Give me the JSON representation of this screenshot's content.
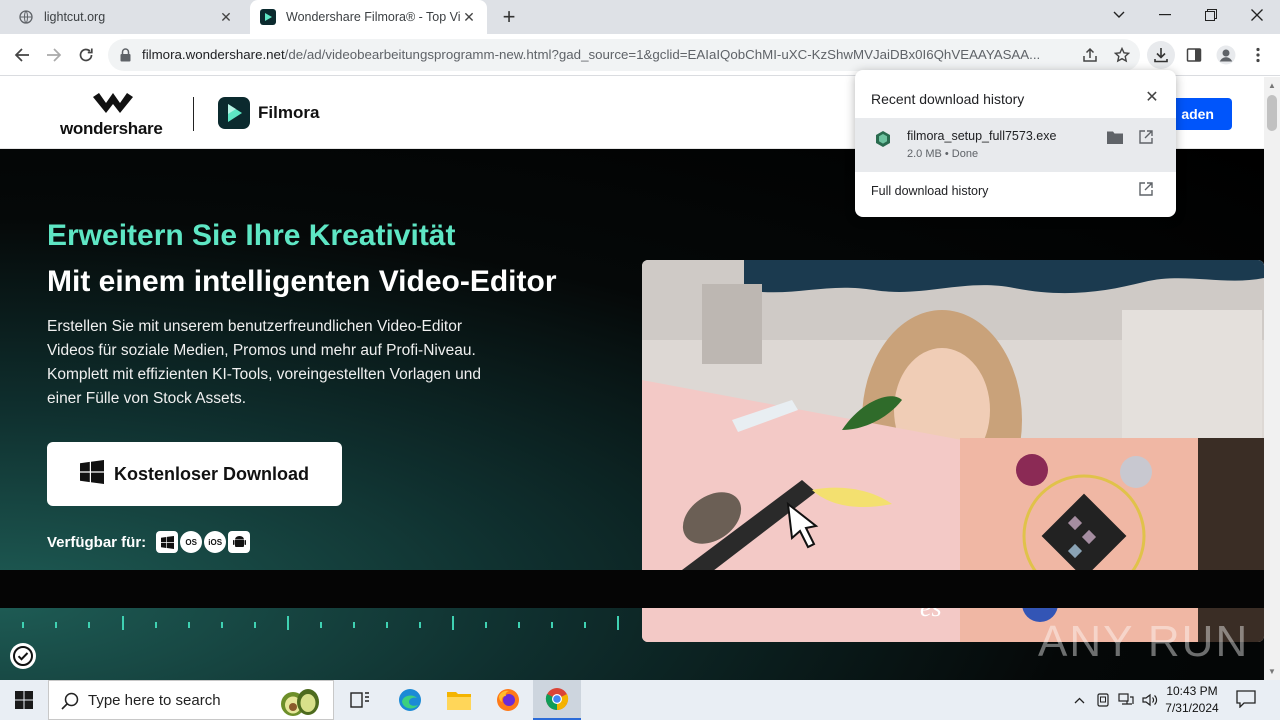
{
  "browser": {
    "tabs": [
      {
        "title": "lightcut.org",
        "active": false
      },
      {
        "title": "Wondershare Filmora® - Top Vi",
        "active": true
      }
    ],
    "new_tab": "+",
    "url_host": "filmora.wondershare.net",
    "url_path": "/de/ad/videobearbeitungsprogramm-new.html?gad_source=1&gclid=EAIaIQobChMI-uXC-KzShwMVJaiDBx0I6QhVEAAYASAA..."
  },
  "site": {
    "brand": "wondershare",
    "product": "Filmora",
    "header_cta": "aden"
  },
  "hero": {
    "title_1": "Erweitern Sie Ihre Kreativität",
    "title_2": "Mit einem intelligenten Video-Editor",
    "desc_1": "Erstellen Sie mit unserem benutzerfreundlichen Video-Editor",
    "desc_2": "Videos für soziale Medien, Promos und mehr auf Profi-Niveau.",
    "desc_3": "Komplett mit effizienten KI-Tools, voreingestellten Vorlagen und",
    "desc_4": "einer Fülle von Stock Assets.",
    "download_button": "Kostenloser Download",
    "available_label": "Verfügbar für:",
    "platforms": [
      "Windows",
      "macOS",
      "iOS",
      "Android"
    ],
    "macos_badge": "OS",
    "ios_badge": "iOS",
    "image_script": "es"
  },
  "download_popup": {
    "title": "Recent download history",
    "file_name": "filmora_setup_full7573.exe",
    "file_meta": "2.0 MB • Done",
    "full_history": "Full download history"
  },
  "watermark": "ANY RUN",
  "taskbar": {
    "search_placeholder": "Type here to search",
    "time": "10:43 PM",
    "date": "7/31/2024"
  },
  "colors": {
    "accent_green": "#5ee6c4",
    "header_cta_blue": "#0055fb",
    "hero_bg": "#050808"
  }
}
